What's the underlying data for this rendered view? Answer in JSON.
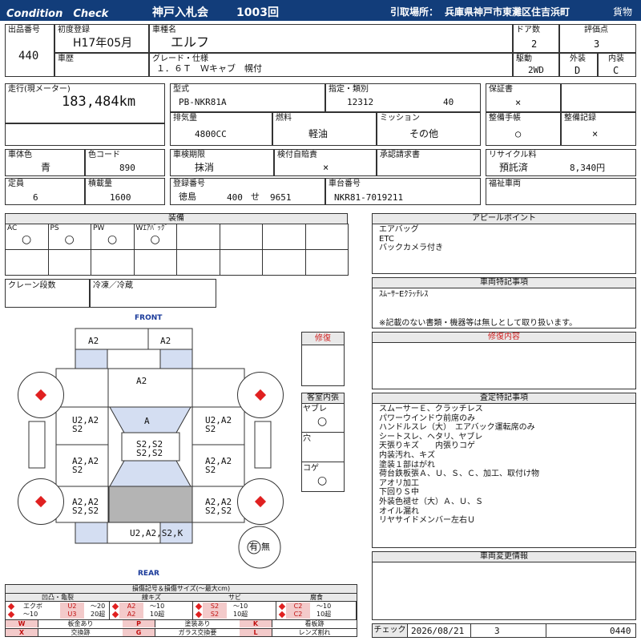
{
  "header": {
    "title": "Condition　Check",
    "auction": "神戸入札会",
    "session": "1003回",
    "pickup_label": "引取場所：",
    "pickup_place": "兵庫県神戸市東灘区住吉浜町",
    "category": "貨物"
  },
  "vehicle": {
    "lot_label": "出品番号",
    "lot": "440",
    "first_reg_label": "初度登録",
    "first_reg": "H17年05月",
    "name_label": "車種名",
    "name": "エルフ",
    "doors_label": "ドア数",
    "doors": "2",
    "score_label": "評価点",
    "score": "3",
    "history_label": "車歴",
    "grade_label": "グレード・仕様",
    "grade": "１．６Ｔ　Ｗキャブ　幌付",
    "drive_label": "駆動",
    "drive": "2WD",
    "exterior_label": "外装",
    "exterior": "D",
    "interior_label": "内装",
    "interior": "C",
    "mileage_label": "走行(現メーター)",
    "mileage": "183,484km",
    "model_label": "型式",
    "model": "PB-NKR81A",
    "designation_label": "指定・類別",
    "designation": "12312",
    "category_no": "40",
    "displacement_label": "排気量",
    "displacement": "4800CC",
    "fuel_label": "燃料",
    "fuel": "軽油",
    "mission_label": "ミッション",
    "mission": "その他",
    "warranty_label": "保証書",
    "warranty": "×",
    "manual_label": "整備手帳",
    "manual": "○",
    "record_label": "整備記録",
    "record": "×",
    "body_color_label": "車体色",
    "body_color": "青",
    "color_code_label": "色コード",
    "color_code": "890",
    "inspection_label": "車検期限",
    "inspection": "抹消",
    "selfcheck_label": "検付自賠責",
    "selfcheck": "×",
    "approval_label": "承認請求書",
    "recycle_label": "リサイクル料",
    "recycle_status": "預託済",
    "recycle_fee": "8,340円",
    "capacity_label": "定員",
    "capacity": "6",
    "load_label": "積載量",
    "load": "1600",
    "plate_label": "登録番号",
    "plate_area": "徳島",
    "plate_class": "400",
    "plate_kana": "せ",
    "plate_num": "9651",
    "chassis_label": "車台番号",
    "chassis": "NKR81-7019211",
    "welfare_label": "福祉車両"
  },
  "equipment": {
    "title": "装備",
    "items": [
      {
        "label": "AC",
        "mark": "○"
      },
      {
        "label": "PS",
        "mark": "○"
      },
      {
        "label": "PW",
        "mark": "○"
      },
      {
        "label": "Wｴｱﾊﾞｯｸﾞ",
        "mark": "○"
      }
    ],
    "crane_label": "クレーン段数",
    "freezer_label": "冷凍／冷蔵"
  },
  "diagram": {
    "front": "FRONT",
    "rear": "REAR",
    "marks": {
      "top_left": "A2",
      "top_right": "A2",
      "hood": "A2",
      "windshield": "A",
      "left_front_door": "U2,A2\nS2",
      "right_front_door": "U2,A2\nS2",
      "cab_center": "S2,S2\nS2,S2",
      "left_mid": "A2,A2\nS2",
      "right_mid": "A2,A2\nS2",
      "left_rear": "A2,A2\nS2,S2",
      "right_rear": "A2,A2\nS2,S2",
      "rear_panel": "U2,A2,S2,K",
      "spare_yes": "有",
      "spare_no": "無"
    }
  },
  "repair": {
    "title": "修復"
  },
  "cabin": {
    "title": "客室内張",
    "items": [
      {
        "label": "ヤブレ",
        "mark": "○"
      },
      {
        "label": "穴",
        "mark": ""
      },
      {
        "label": "コゲ",
        "mark": "○"
      }
    ]
  },
  "appeal": {
    "title": "アピールポイント",
    "lines": [
      "エアバッグ",
      "ETC",
      "バックカメラ付き"
    ]
  },
  "special": {
    "title": "車両特記事項",
    "lines": [
      "ｽﾑｰｻｰEｸﾗｯﾁﾚｽ"
    ],
    "note": "※記載のない書類・機器等は無しとして取り扱います。"
  },
  "repair_detail": {
    "title": "修復内容"
  },
  "inspection_notes": {
    "title": "査定特記事項",
    "lines": [
      "スムーサーＥ、クラッチレス",
      "パワーウインドウ前席のみ",
      "ハンドルスレ（大）　エアバック運転席のみ",
      "シートスレ、ヘタリ、ヤブレ",
      "天張りキズ　　内張りコゲ",
      "内装汚れ、キズ",
      "塗装１部はがれ",
      "荷台鉄板張Ａ、Ｕ、Ｓ、Ｃ、加工、取付け物",
      "アオリ加工",
      "下回りＳ中",
      "外装色褪せ（大）Ａ、Ｕ、Ｓ",
      "オイル漏れ",
      "リヤサイドメンバー左右Ｕ"
    ]
  },
  "change_info": {
    "title": "車両変更情報"
  },
  "check": {
    "label": "チェック",
    "date": "2026/08/21",
    "num": "3",
    "code": "0440"
  },
  "legend": {
    "title": "損傷記号＆損傷サイズ(～最大cm)",
    "groups": [
      {
        "name": "凹凸・亀裂",
        "rows": [
          [
            "エクボ",
            "U2",
            "～20"
          ],
          [
            "～10",
            "U3",
            "20超"
          ]
        ]
      },
      {
        "name": "線キズ",
        "rows": [
          [
            "A2",
            "～10"
          ],
          [
            "A2",
            "10超"
          ]
        ]
      },
      {
        "name": "サビ",
        "rows": [
          [
            "S2",
            "～10"
          ],
          [
            "S2",
            "10超"
          ]
        ]
      },
      {
        "name": "腐食",
        "rows": [
          [
            "C2",
            "～10"
          ],
          [
            "C2",
            "10超"
          ]
        ]
      }
    ],
    "codes": [
      {
        "k": "W",
        "v": "板金あり"
      },
      {
        "k": "P",
        "v": "塗装あり"
      },
      {
        "k": "K",
        "v": "看板跡"
      },
      {
        "k": "X",
        "v": "交換跡"
      },
      {
        "k": "G",
        "v": "ガラス交換要"
      },
      {
        "k": "L",
        "v": "レンズ割れ"
      }
    ]
  }
}
